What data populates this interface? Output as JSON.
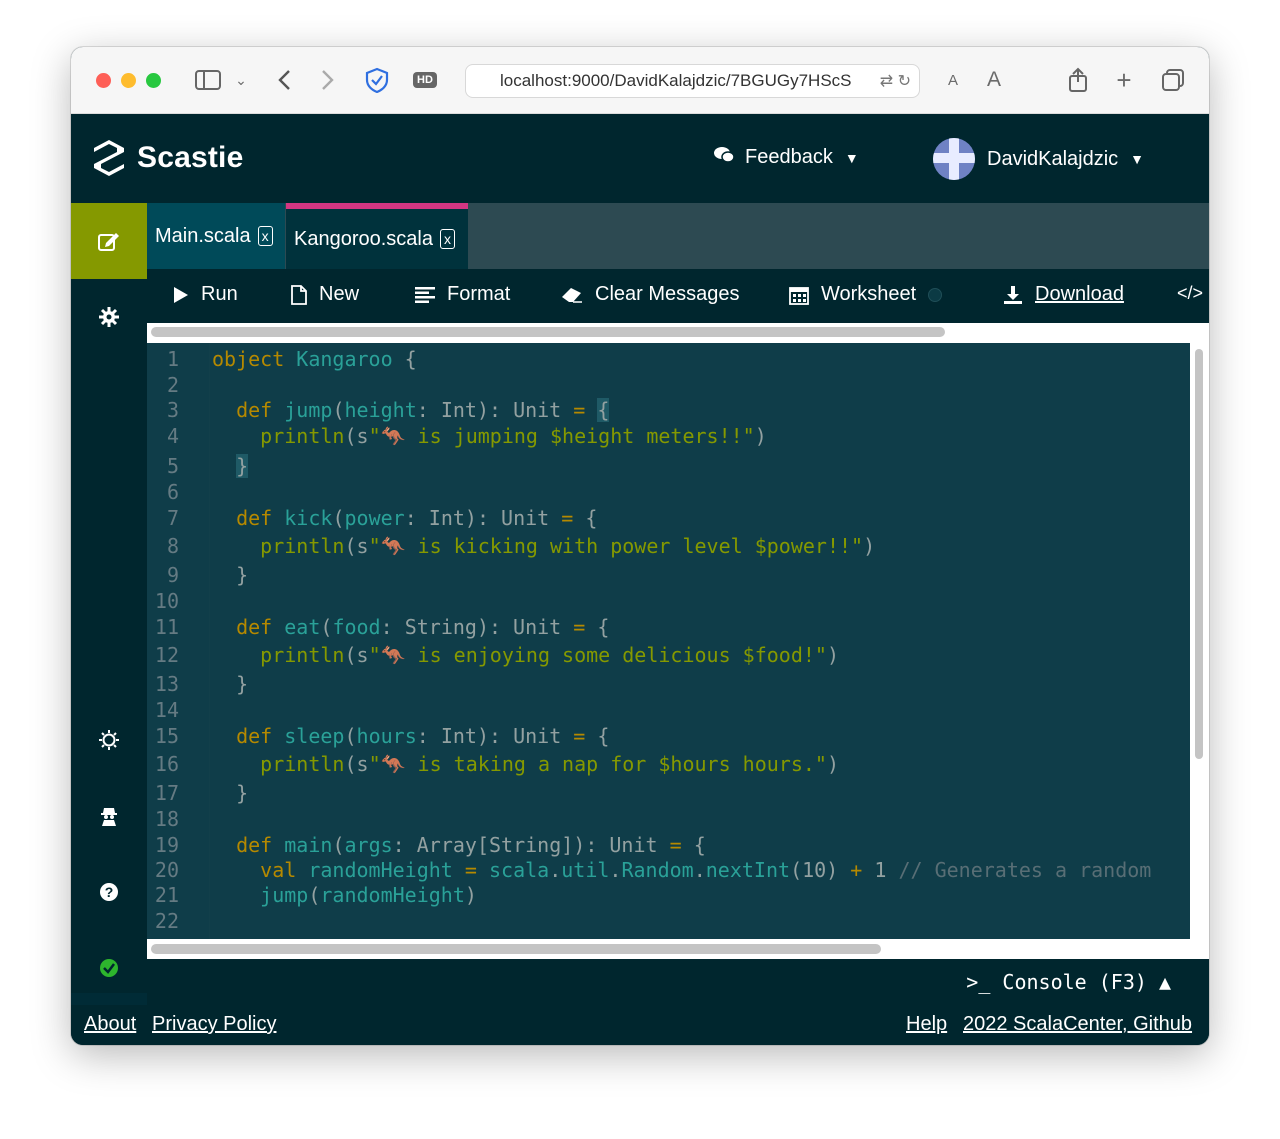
{
  "browser": {
    "url": "localhost:9000/DavidKalajdzic/7BGUGy7HScS",
    "hd_label": "HD",
    "text_size_small": "A",
    "text_size_large": "A"
  },
  "header": {
    "app_name": "Scastie",
    "feedback_label": "Feedback",
    "username": "DavidKalajdzic"
  },
  "tabs": [
    {
      "label": "Main.scala",
      "close": "x"
    },
    {
      "label": "Kangoroo.scala",
      "close": "x"
    }
  ],
  "toolbar": {
    "run": "Run",
    "new": "New",
    "format": "Format",
    "clear": "Clear Messages",
    "worksheet": "Worksheet",
    "download": "Download",
    "embed": "</>"
  },
  "editor": {
    "line_numbers": [
      "1",
      "2",
      "3",
      "4",
      "5",
      "6",
      "7",
      "8",
      "9",
      "10",
      "11",
      "12",
      "13",
      "14",
      "15",
      "16",
      "17",
      "18",
      "19",
      "20",
      "21",
      "22"
    ],
    "lines": [
      "object Kangaroo {",
      "",
      "  def jump(height: Int): Unit = {",
      "    println(s\"🦘 is jumping $height meters!!\")",
      "  }",
      "",
      "  def kick(power: Int): Unit = {",
      "    println(s\"🦘 is kicking with power level $power!!\")",
      "  }",
      "",
      "  def eat(food: String): Unit = {",
      "    println(s\"🦘 is enjoying some delicious $food!\")",
      "  }",
      "",
      "  def sleep(hours: Int): Unit = {",
      "    println(s\"🦘 is taking a nap for $hours hours.\")",
      "  }",
      "",
      "  def main(args: Array[String]): Unit = {",
      "    val randomHeight = scala.util.Random.nextInt(10) + 1 // Generates a random",
      "    jump(randomHeight)",
      ""
    ]
  },
  "console": {
    "label": ">_ Console (F3) ▲"
  },
  "footer": {
    "about": "About",
    "privacy": "Privacy Policy",
    "help": "Help",
    "copyright": "2022 ScalaCenter, Github"
  },
  "colors": {
    "header_bg": "#00262e",
    "editor_bg": "#0f3d49",
    "accent_active": "#859900",
    "tab_indicator": "#d33682",
    "keyword": "#b58900",
    "identifier": "#2aa198",
    "string": "#859900"
  }
}
